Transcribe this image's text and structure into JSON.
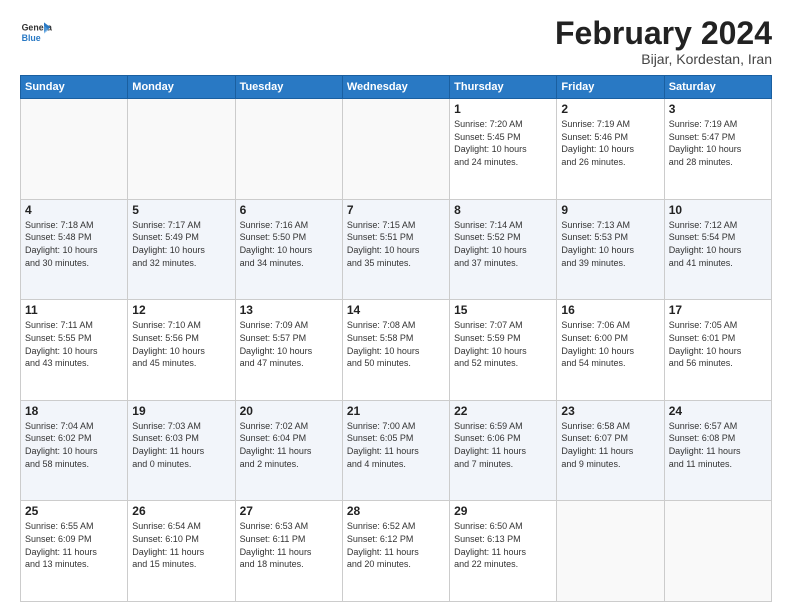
{
  "header": {
    "logo_line1": "General",
    "logo_line2": "Blue",
    "month": "February 2024",
    "location": "Bijar, Kordestan, Iran"
  },
  "weekdays": [
    "Sunday",
    "Monday",
    "Tuesday",
    "Wednesday",
    "Thursday",
    "Friday",
    "Saturday"
  ],
  "weeks": [
    {
      "days": [
        {
          "num": "",
          "info": ""
        },
        {
          "num": "",
          "info": ""
        },
        {
          "num": "",
          "info": ""
        },
        {
          "num": "",
          "info": ""
        },
        {
          "num": "1",
          "info": "Sunrise: 7:20 AM\nSunset: 5:45 PM\nDaylight: 10 hours\nand 24 minutes."
        },
        {
          "num": "2",
          "info": "Sunrise: 7:19 AM\nSunset: 5:46 PM\nDaylight: 10 hours\nand 26 minutes."
        },
        {
          "num": "3",
          "info": "Sunrise: 7:19 AM\nSunset: 5:47 PM\nDaylight: 10 hours\nand 28 minutes."
        }
      ]
    },
    {
      "stripe": true,
      "days": [
        {
          "num": "4",
          "info": "Sunrise: 7:18 AM\nSunset: 5:48 PM\nDaylight: 10 hours\nand 30 minutes."
        },
        {
          "num": "5",
          "info": "Sunrise: 7:17 AM\nSunset: 5:49 PM\nDaylight: 10 hours\nand 32 minutes."
        },
        {
          "num": "6",
          "info": "Sunrise: 7:16 AM\nSunset: 5:50 PM\nDaylight: 10 hours\nand 34 minutes."
        },
        {
          "num": "7",
          "info": "Sunrise: 7:15 AM\nSunset: 5:51 PM\nDaylight: 10 hours\nand 35 minutes."
        },
        {
          "num": "8",
          "info": "Sunrise: 7:14 AM\nSunset: 5:52 PM\nDaylight: 10 hours\nand 37 minutes."
        },
        {
          "num": "9",
          "info": "Sunrise: 7:13 AM\nSunset: 5:53 PM\nDaylight: 10 hours\nand 39 minutes."
        },
        {
          "num": "10",
          "info": "Sunrise: 7:12 AM\nSunset: 5:54 PM\nDaylight: 10 hours\nand 41 minutes."
        }
      ]
    },
    {
      "stripe": false,
      "days": [
        {
          "num": "11",
          "info": "Sunrise: 7:11 AM\nSunset: 5:55 PM\nDaylight: 10 hours\nand 43 minutes."
        },
        {
          "num": "12",
          "info": "Sunrise: 7:10 AM\nSunset: 5:56 PM\nDaylight: 10 hours\nand 45 minutes."
        },
        {
          "num": "13",
          "info": "Sunrise: 7:09 AM\nSunset: 5:57 PM\nDaylight: 10 hours\nand 47 minutes."
        },
        {
          "num": "14",
          "info": "Sunrise: 7:08 AM\nSunset: 5:58 PM\nDaylight: 10 hours\nand 50 minutes."
        },
        {
          "num": "15",
          "info": "Sunrise: 7:07 AM\nSunset: 5:59 PM\nDaylight: 10 hours\nand 52 minutes."
        },
        {
          "num": "16",
          "info": "Sunrise: 7:06 AM\nSunset: 6:00 PM\nDaylight: 10 hours\nand 54 minutes."
        },
        {
          "num": "17",
          "info": "Sunrise: 7:05 AM\nSunset: 6:01 PM\nDaylight: 10 hours\nand 56 minutes."
        }
      ]
    },
    {
      "stripe": true,
      "days": [
        {
          "num": "18",
          "info": "Sunrise: 7:04 AM\nSunset: 6:02 PM\nDaylight: 10 hours\nand 58 minutes."
        },
        {
          "num": "19",
          "info": "Sunrise: 7:03 AM\nSunset: 6:03 PM\nDaylight: 11 hours\nand 0 minutes."
        },
        {
          "num": "20",
          "info": "Sunrise: 7:02 AM\nSunset: 6:04 PM\nDaylight: 11 hours\nand 2 minutes."
        },
        {
          "num": "21",
          "info": "Sunrise: 7:00 AM\nSunset: 6:05 PM\nDaylight: 11 hours\nand 4 minutes."
        },
        {
          "num": "22",
          "info": "Sunrise: 6:59 AM\nSunset: 6:06 PM\nDaylight: 11 hours\nand 7 minutes."
        },
        {
          "num": "23",
          "info": "Sunrise: 6:58 AM\nSunset: 6:07 PM\nDaylight: 11 hours\nand 9 minutes."
        },
        {
          "num": "24",
          "info": "Sunrise: 6:57 AM\nSunset: 6:08 PM\nDaylight: 11 hours\nand 11 minutes."
        }
      ]
    },
    {
      "stripe": false,
      "days": [
        {
          "num": "25",
          "info": "Sunrise: 6:55 AM\nSunset: 6:09 PM\nDaylight: 11 hours\nand 13 minutes."
        },
        {
          "num": "26",
          "info": "Sunrise: 6:54 AM\nSunset: 6:10 PM\nDaylight: 11 hours\nand 15 minutes."
        },
        {
          "num": "27",
          "info": "Sunrise: 6:53 AM\nSunset: 6:11 PM\nDaylight: 11 hours\nand 18 minutes."
        },
        {
          "num": "28",
          "info": "Sunrise: 6:52 AM\nSunset: 6:12 PM\nDaylight: 11 hours\nand 20 minutes."
        },
        {
          "num": "29",
          "info": "Sunrise: 6:50 AM\nSunset: 6:13 PM\nDaylight: 11 hours\nand 22 minutes."
        },
        {
          "num": "",
          "info": ""
        },
        {
          "num": "",
          "info": ""
        }
      ]
    }
  ]
}
